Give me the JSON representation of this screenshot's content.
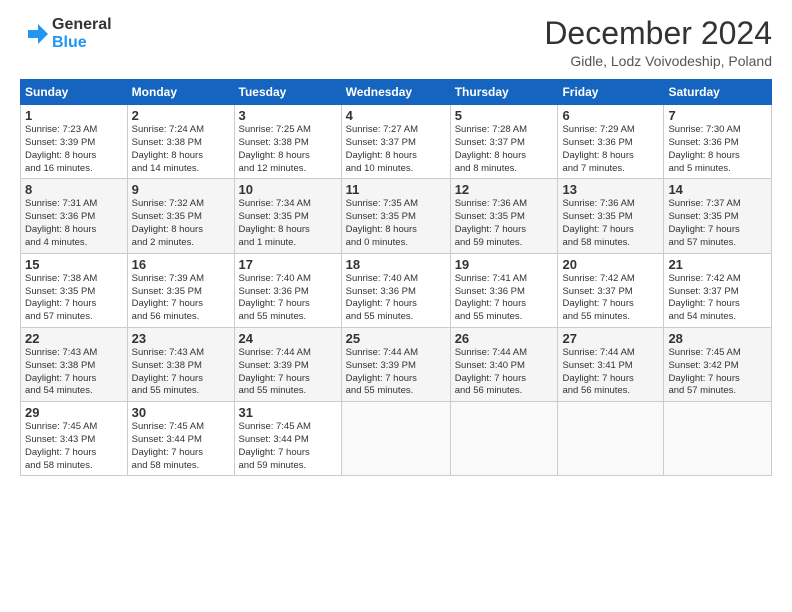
{
  "header": {
    "logo_line1": "General",
    "logo_line2": "Blue",
    "main_title": "December 2024",
    "subtitle": "Gidle, Lodz Voivodeship, Poland"
  },
  "calendar": {
    "headers": [
      "Sunday",
      "Monday",
      "Tuesday",
      "Wednesday",
      "Thursday",
      "Friday",
      "Saturday"
    ],
    "weeks": [
      [
        {
          "day": "",
          "info": ""
        },
        {
          "day": "",
          "info": ""
        },
        {
          "day": "",
          "info": ""
        },
        {
          "day": "",
          "info": ""
        },
        {
          "day": "",
          "info": ""
        },
        {
          "day": "",
          "info": ""
        },
        {
          "day": "",
          "info": ""
        }
      ],
      [
        {
          "day": "1",
          "info": "Sunrise: 7:23 AM\nSunset: 3:39 PM\nDaylight: 8 hours\nand 16 minutes."
        },
        {
          "day": "2",
          "info": "Sunrise: 7:24 AM\nSunset: 3:38 PM\nDaylight: 8 hours\nand 14 minutes."
        },
        {
          "day": "3",
          "info": "Sunrise: 7:25 AM\nSunset: 3:38 PM\nDaylight: 8 hours\nand 12 minutes."
        },
        {
          "day": "4",
          "info": "Sunrise: 7:27 AM\nSunset: 3:37 PM\nDaylight: 8 hours\nand 10 minutes."
        },
        {
          "day": "5",
          "info": "Sunrise: 7:28 AM\nSunset: 3:37 PM\nDaylight: 8 hours\nand 8 minutes."
        },
        {
          "day": "6",
          "info": "Sunrise: 7:29 AM\nSunset: 3:36 PM\nDaylight: 8 hours\nand 7 minutes."
        },
        {
          "day": "7",
          "info": "Sunrise: 7:30 AM\nSunset: 3:36 PM\nDaylight: 8 hours\nand 5 minutes."
        }
      ],
      [
        {
          "day": "8",
          "info": "Sunrise: 7:31 AM\nSunset: 3:36 PM\nDaylight: 8 hours\nand 4 minutes."
        },
        {
          "day": "9",
          "info": "Sunrise: 7:32 AM\nSunset: 3:35 PM\nDaylight: 8 hours\nand 2 minutes."
        },
        {
          "day": "10",
          "info": "Sunrise: 7:34 AM\nSunset: 3:35 PM\nDaylight: 8 hours\nand 1 minute."
        },
        {
          "day": "11",
          "info": "Sunrise: 7:35 AM\nSunset: 3:35 PM\nDaylight: 8 hours\nand 0 minutes."
        },
        {
          "day": "12",
          "info": "Sunrise: 7:36 AM\nSunset: 3:35 PM\nDaylight: 7 hours\nand 59 minutes."
        },
        {
          "day": "13",
          "info": "Sunrise: 7:36 AM\nSunset: 3:35 PM\nDaylight: 7 hours\nand 58 minutes."
        },
        {
          "day": "14",
          "info": "Sunrise: 7:37 AM\nSunset: 3:35 PM\nDaylight: 7 hours\nand 57 minutes."
        }
      ],
      [
        {
          "day": "15",
          "info": "Sunrise: 7:38 AM\nSunset: 3:35 PM\nDaylight: 7 hours\nand 57 minutes."
        },
        {
          "day": "16",
          "info": "Sunrise: 7:39 AM\nSunset: 3:35 PM\nDaylight: 7 hours\nand 56 minutes."
        },
        {
          "day": "17",
          "info": "Sunrise: 7:40 AM\nSunset: 3:36 PM\nDaylight: 7 hours\nand 55 minutes."
        },
        {
          "day": "18",
          "info": "Sunrise: 7:40 AM\nSunset: 3:36 PM\nDaylight: 7 hours\nand 55 minutes."
        },
        {
          "day": "19",
          "info": "Sunrise: 7:41 AM\nSunset: 3:36 PM\nDaylight: 7 hours\nand 55 minutes."
        },
        {
          "day": "20",
          "info": "Sunrise: 7:42 AM\nSunset: 3:37 PM\nDaylight: 7 hours\nand 55 minutes."
        },
        {
          "day": "21",
          "info": "Sunrise: 7:42 AM\nSunset: 3:37 PM\nDaylight: 7 hours\nand 54 minutes."
        }
      ],
      [
        {
          "day": "22",
          "info": "Sunrise: 7:43 AM\nSunset: 3:38 PM\nDaylight: 7 hours\nand 54 minutes."
        },
        {
          "day": "23",
          "info": "Sunrise: 7:43 AM\nSunset: 3:38 PM\nDaylight: 7 hours\nand 55 minutes."
        },
        {
          "day": "24",
          "info": "Sunrise: 7:44 AM\nSunset: 3:39 PM\nDaylight: 7 hours\nand 55 minutes."
        },
        {
          "day": "25",
          "info": "Sunrise: 7:44 AM\nSunset: 3:39 PM\nDaylight: 7 hours\nand 55 minutes."
        },
        {
          "day": "26",
          "info": "Sunrise: 7:44 AM\nSunset: 3:40 PM\nDaylight: 7 hours\nand 56 minutes."
        },
        {
          "day": "27",
          "info": "Sunrise: 7:44 AM\nSunset: 3:41 PM\nDaylight: 7 hours\nand 56 minutes."
        },
        {
          "day": "28",
          "info": "Sunrise: 7:45 AM\nSunset: 3:42 PM\nDaylight: 7 hours\nand 57 minutes."
        }
      ],
      [
        {
          "day": "29",
          "info": "Sunrise: 7:45 AM\nSunset: 3:43 PM\nDaylight: 7 hours\nand 58 minutes."
        },
        {
          "day": "30",
          "info": "Sunrise: 7:45 AM\nSunset: 3:44 PM\nDaylight: 7 hours\nand 58 minutes."
        },
        {
          "day": "31",
          "info": "Sunrise: 7:45 AM\nSunset: 3:44 PM\nDaylight: 7 hours\nand 59 minutes."
        },
        {
          "day": "",
          "info": ""
        },
        {
          "day": "",
          "info": ""
        },
        {
          "day": "",
          "info": ""
        },
        {
          "day": "",
          "info": ""
        }
      ]
    ]
  }
}
